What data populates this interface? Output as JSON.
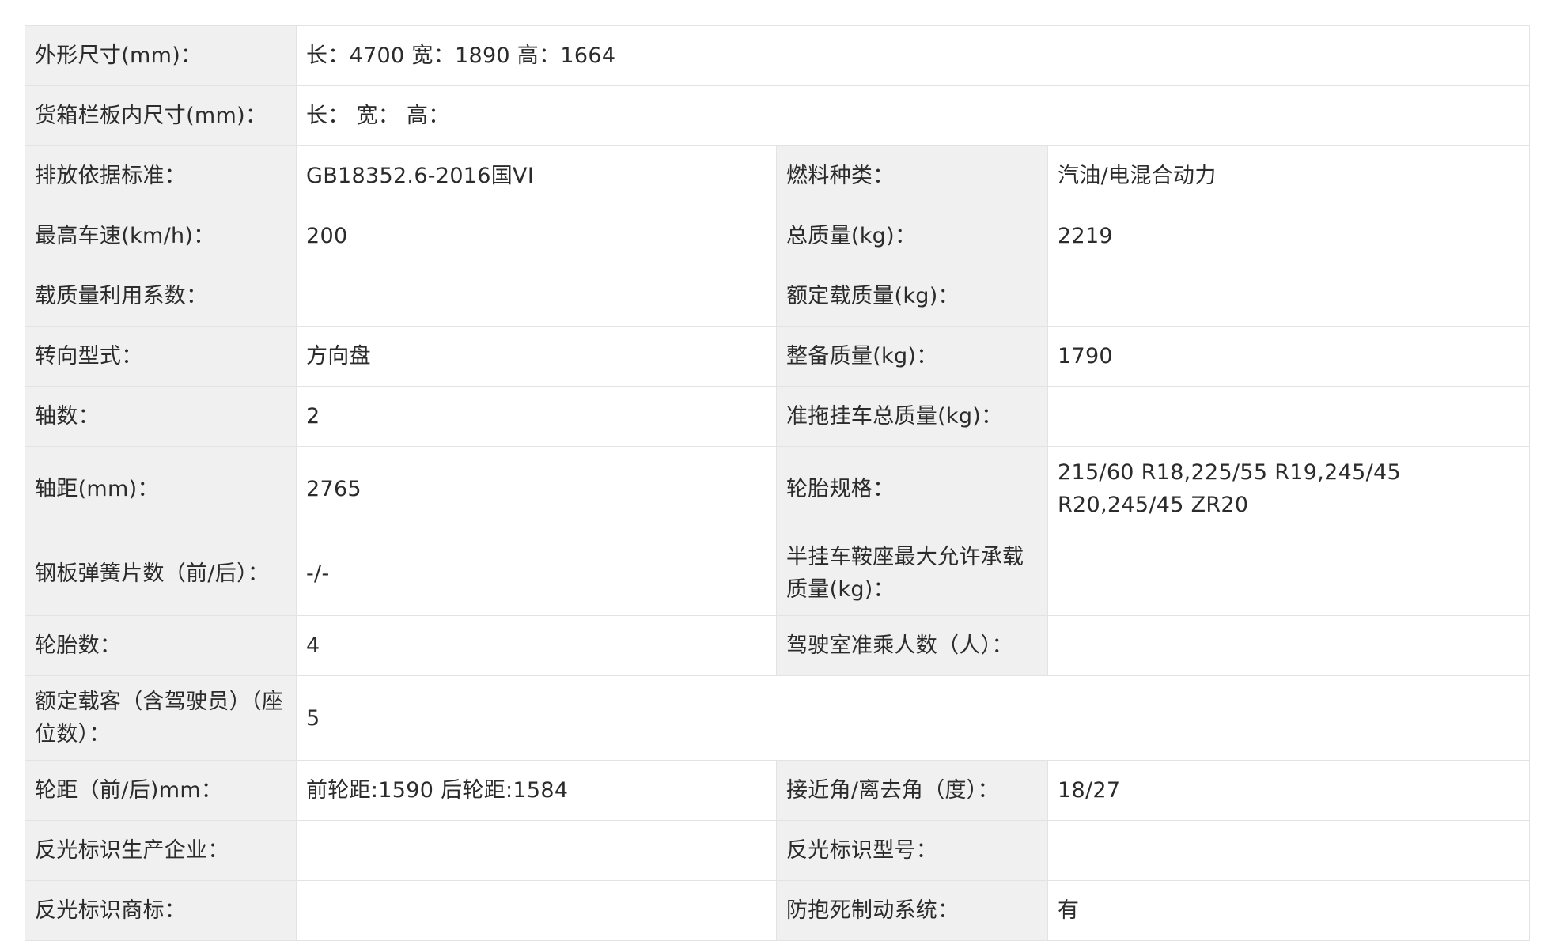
{
  "rows": [
    {
      "cells": [
        {
          "label": "外形尺寸(mm)：",
          "value": "长：4700 宽：1890 高：1664",
          "span": 3
        }
      ]
    },
    {
      "cells": [
        {
          "label": "货箱栏板内尺寸(mm)：",
          "value": "长：  宽：  高：",
          "span": 3
        }
      ]
    },
    {
      "cells": [
        {
          "label": "排放依据标准：",
          "value": "GB18352.6-2016国VI"
        },
        {
          "label": "燃料种类：",
          "value": "汽油/电混合动力"
        }
      ]
    },
    {
      "cells": [
        {
          "label": "最高车速(km/h)：",
          "value": "200"
        },
        {
          "label": "总质量(kg)：",
          "value": "2219"
        }
      ]
    },
    {
      "cells": [
        {
          "label": "载质量利用系数：",
          "value": ""
        },
        {
          "label": "额定载质量(kg)：",
          "value": ""
        }
      ]
    },
    {
      "cells": [
        {
          "label": "转向型式：",
          "value": "方向盘"
        },
        {
          "label": "整备质量(kg)：",
          "value": "1790"
        }
      ]
    },
    {
      "cells": [
        {
          "label": "轴数：",
          "value": "2"
        },
        {
          "label": "准拖挂车总质量(kg)：",
          "value": ""
        }
      ]
    },
    {
      "tall": true,
      "cells": [
        {
          "label": "轴距(mm)：",
          "value": "2765"
        },
        {
          "label": "轮胎规格：",
          "value": "215/60 R18,225/55 R19,245/45 R20,245/45 ZR20"
        }
      ]
    },
    {
      "tall": true,
      "cells": [
        {
          "label": "钢板弹簧片数（前/后）：",
          "value": "-/-"
        },
        {
          "label": "半挂车鞍座最大允许承载质量(kg)：",
          "value": ""
        }
      ]
    },
    {
      "cells": [
        {
          "label": "轮胎数：",
          "value": "4"
        },
        {
          "label": "驾驶室准乘人数（人）：",
          "value": ""
        }
      ]
    },
    {
      "tall": true,
      "cells": [
        {
          "label": "额定载客（含驾驶员）（座位数）：",
          "value": "5",
          "span": 3
        }
      ]
    },
    {
      "cells": [
        {
          "label": "轮距（前/后)mm：",
          "value": "前轮距:1590 后轮距:1584"
        },
        {
          "label": "接近角/离去角（度）：",
          "value": "18/27"
        }
      ]
    },
    {
      "cells": [
        {
          "label": "反光标识生产企业：",
          "value": ""
        },
        {
          "label": "反光标识型号：",
          "value": ""
        }
      ]
    },
    {
      "cells": [
        {
          "label": "反光标识商标：",
          "value": ""
        },
        {
          "label": "防抱死制动系统：",
          "value": "有"
        }
      ]
    }
  ]
}
